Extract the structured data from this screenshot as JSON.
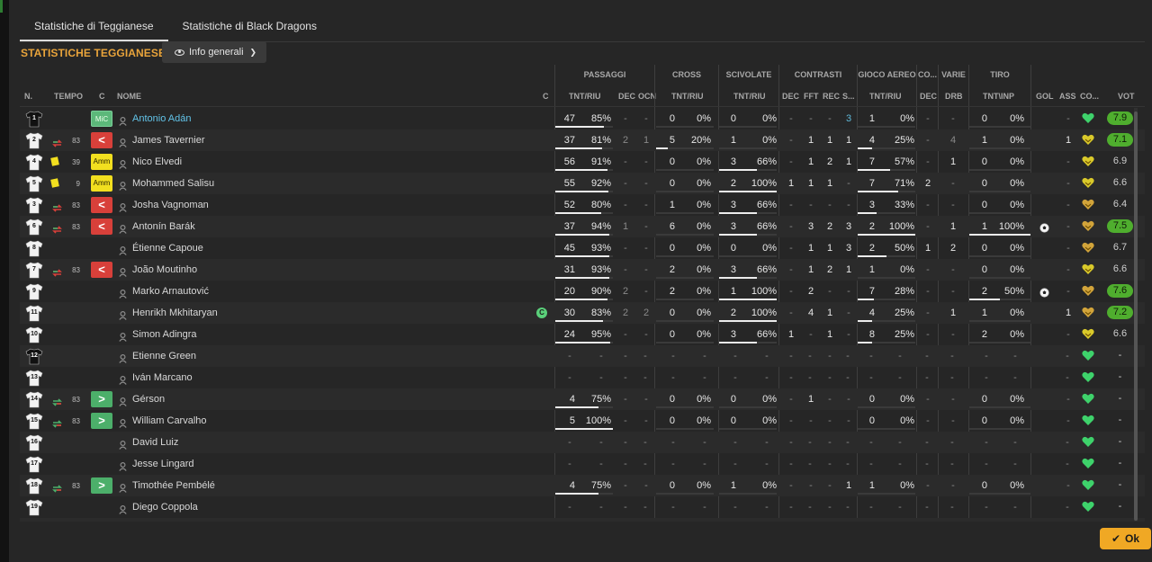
{
  "tabs": [
    {
      "label": "Statistiche di Teggianese",
      "active": true
    },
    {
      "label": "Statistiche di Black Dragons",
      "active": false
    }
  ],
  "section_title": "STATISTICHE TEGGIANESE",
  "view_dropdown": {
    "label": "Info generali"
  },
  "ok_button": {
    "label": "Ok"
  },
  "group_headers": {
    "passaggi": "PASSAGGI",
    "cross": "CROSS",
    "scivolate": "SCIVOLATE",
    "contrasti": "CONTRASTI",
    "gioco_aereo": "GIOCO AEREO",
    "co": "CO...",
    "varie": "VARIE",
    "tiro": "TIRO"
  },
  "column_headers": {
    "n": "N.",
    "tempo": "TEMPO",
    "c": "C",
    "nome": "NOME",
    "cap": "C",
    "pass_tnt_riu": "TNT/RIU",
    "pass_dec": "DEC",
    "pass_ocn": "OCN",
    "cross_tnt_riu": "TNT/RIU",
    "sciv_tnt_riu": "TNT/RIU",
    "contr_dec": "DEC",
    "contr_fft": "FFT",
    "contr_rec": "REC",
    "contr_s": "S...",
    "aereo_tnt_riu": "TNT/RIU",
    "co_dec": "DEC",
    "varie_drb": "DRB",
    "tiro_tnt_inp": "TNT\\INP",
    "gol": "GOL",
    "ass": "ASS",
    "co": "CO...",
    "vot": "VOT"
  },
  "colors": {
    "accent": "#e9a43b",
    "selected_name": "#62c3e8",
    "rating_good": "#4fae2e",
    "sub_out": "#d8403a",
    "sub_in": "#4caf6a",
    "yellow_card": "#f2df1f",
    "heart_green": "#3ed26b",
    "heart_yellow": "#d9c92a",
    "heart_gold": "#d2a43a"
  },
  "players": [
    {
      "n": "1",
      "gk": true,
      "cond": {
        "type": "mic",
        "label": "MiC"
      },
      "name": "Antonio Adán",
      "selected": true,
      "pass": {
        "t": "47",
        "p": "85%",
        "pct": 85,
        "dec": "-",
        "ocn": "-"
      },
      "cross": {
        "t": "0",
        "p": "0%",
        "pct": 0
      },
      "sciv": {
        "t": "0",
        "p": "0%",
        "pct": 0
      },
      "contr": [
        "-",
        "-",
        "-",
        "3"
      ],
      "aereo": {
        "t": "1",
        "p": "0%",
        "pct": 0
      },
      "codec": "-",
      "drb": "-",
      "tiro": {
        "t": "0",
        "p": "0%",
        "pct": 0
      },
      "gol": "",
      "ass": "-",
      "heart": "green",
      "vot": "7.9",
      "vot_good": true
    },
    {
      "n": "2",
      "sub": "out",
      "minute": "83",
      "cond": {
        "type": "out",
        "label": "<"
      },
      "name": "James Tavernier",
      "pass": {
        "t": "37",
        "p": "81%",
        "pct": 81,
        "dec": "2",
        "ocn": "1"
      },
      "cross": {
        "t": "5",
        "p": "20%",
        "pct": 20
      },
      "sciv": {
        "t": "1",
        "p": "0%",
        "pct": 0
      },
      "contr": [
        "-",
        "1",
        "1",
        "1"
      ],
      "aereo": {
        "t": "4",
        "p": "25%",
        "pct": 25
      },
      "codec": "-",
      "drb": "4",
      "tiro": {
        "t": "1",
        "p": "0%",
        "pct": 0
      },
      "gol": "",
      "ass": "1",
      "heart": "yellow",
      "vot": "7.1",
      "vot_good": true
    },
    {
      "n": "4",
      "card": "yellow",
      "minute": "39",
      "cond": {
        "type": "amm",
        "label": "Amm"
      },
      "name": "Nico Elvedi",
      "pass": {
        "t": "56",
        "p": "91%",
        "pct": 91,
        "dec": "-",
        "ocn": "-"
      },
      "cross": {
        "t": "0",
        "p": "0%",
        "pct": 0
      },
      "sciv": {
        "t": "3",
        "p": "66%",
        "pct": 66
      },
      "contr": [
        "-",
        "1",
        "2",
        "1"
      ],
      "aereo": {
        "t": "7",
        "p": "57%",
        "pct": 57
      },
      "codec": "-",
      "drb": "1",
      "tiro": {
        "t": "0",
        "p": "0%",
        "pct": 0
      },
      "gol": "",
      "ass": "-",
      "heart": "yellow",
      "vot": "6.9",
      "vot_good": false
    },
    {
      "n": "5",
      "card": "yellow",
      "minute": "9",
      "cond": {
        "type": "amm",
        "label": "Amm"
      },
      "name": "Mohammed Salisu",
      "pass": {
        "t": "55",
        "p": "92%",
        "pct": 92,
        "dec": "-",
        "ocn": "-"
      },
      "cross": {
        "t": "0",
        "p": "0%",
        "pct": 0
      },
      "sciv": {
        "t": "2",
        "p": "100%",
        "pct": 100
      },
      "contr": [
        "1",
        "1",
        "1",
        "-"
      ],
      "aereo": {
        "t": "7",
        "p": "71%",
        "pct": 71
      },
      "codec": "2",
      "drb": "-",
      "tiro": {
        "t": "0",
        "p": "0%",
        "pct": 0
      },
      "gol": "",
      "ass": "-",
      "heart": "yellow",
      "vot": "6.6",
      "vot_good": false
    },
    {
      "n": "3",
      "sub": "out",
      "minute": "83",
      "cond": {
        "type": "out",
        "label": "<"
      },
      "name": "Josha Vagnoman",
      "pass": {
        "t": "52",
        "p": "80%",
        "pct": 80,
        "dec": "-",
        "ocn": "-"
      },
      "cross": {
        "t": "1",
        "p": "0%",
        "pct": 0
      },
      "sciv": {
        "t": "3",
        "p": "66%",
        "pct": 66
      },
      "contr": [
        "-",
        "-",
        "-",
        "-"
      ],
      "aereo": {
        "t": "3",
        "p": "33%",
        "pct": 33
      },
      "codec": "-",
      "drb": "-",
      "tiro": {
        "t": "0",
        "p": "0%",
        "pct": 0
      },
      "gol": "",
      "ass": "-",
      "heart": "gold",
      "vot": "6.4",
      "vot_good": false
    },
    {
      "n": "6",
      "sub": "out",
      "minute": "83",
      "cond": {
        "type": "out",
        "label": "<"
      },
      "name": "Antonín Barák",
      "pass": {
        "t": "37",
        "p": "94%",
        "pct": 94,
        "dec": "1",
        "ocn": "-"
      },
      "cross": {
        "t": "6",
        "p": "0%",
        "pct": 0
      },
      "sciv": {
        "t": "3",
        "p": "66%",
        "pct": 66
      },
      "contr": [
        "-",
        "3",
        "2",
        "3"
      ],
      "aereo": {
        "t": "2",
        "p": "100%",
        "pct": 100
      },
      "codec": "-",
      "drb": "1",
      "tiro": {
        "t": "1",
        "p": "100%",
        "pct": 100
      },
      "gol": "ball",
      "ass": "-",
      "heart": "gold",
      "vot": "7.5",
      "vot_good": true
    },
    {
      "n": "8",
      "name": "Étienne Capoue",
      "pass": {
        "t": "45",
        "p": "93%",
        "pct": 93,
        "dec": "-",
        "ocn": "-"
      },
      "cross": {
        "t": "0",
        "p": "0%",
        "pct": 0
      },
      "sciv": {
        "t": "0",
        "p": "0%",
        "pct": 0
      },
      "contr": [
        "-",
        "1",
        "1",
        "3"
      ],
      "aereo": {
        "t": "2",
        "p": "50%",
        "pct": 50
      },
      "codec": "1",
      "drb": "2",
      "tiro": {
        "t": "0",
        "p": "0%",
        "pct": 0
      },
      "gol": "",
      "ass": "-",
      "heart": "gold",
      "vot": "6.7",
      "vot_good": false
    },
    {
      "n": "7",
      "sub": "out",
      "minute": "83",
      "cond": {
        "type": "out",
        "label": "<"
      },
      "name": "João Moutinho",
      "pass": {
        "t": "31",
        "p": "93%",
        "pct": 93,
        "dec": "-",
        "ocn": "-"
      },
      "cross": {
        "t": "2",
        "p": "0%",
        "pct": 0
      },
      "sciv": {
        "t": "3",
        "p": "66%",
        "pct": 66
      },
      "contr": [
        "-",
        "1",
        "2",
        "1"
      ],
      "aereo": {
        "t": "1",
        "p": "0%",
        "pct": 0
      },
      "codec": "-",
      "drb": "-",
      "tiro": {
        "t": "0",
        "p": "0%",
        "pct": 0
      },
      "gol": "",
      "ass": "-",
      "heart": "yellow",
      "vot": "6.6",
      "vot_good": false
    },
    {
      "n": "9",
      "name": "Marko Arnautović",
      "pass": {
        "t": "20",
        "p": "90%",
        "pct": 90,
        "dec": "2",
        "ocn": "-"
      },
      "cross": {
        "t": "2",
        "p": "0%",
        "pct": 0
      },
      "sciv": {
        "t": "1",
        "p": "100%",
        "pct": 100
      },
      "contr": [
        "-",
        "2",
        "-",
        "-"
      ],
      "aereo": {
        "t": "7",
        "p": "28%",
        "pct": 28
      },
      "codec": "-",
      "drb": "-",
      "tiro": {
        "t": "2",
        "p": "50%",
        "pct": 50
      },
      "gol": "ball",
      "ass": "-",
      "heart": "gold",
      "vot": "7.6",
      "vot_good": true
    },
    {
      "n": "11",
      "captain": true,
      "name": "Henrikh Mkhitaryan",
      "pass": {
        "t": "30",
        "p": "83%",
        "pct": 83,
        "dec": "2",
        "ocn": "2"
      },
      "cross": {
        "t": "0",
        "p": "0%",
        "pct": 0
      },
      "sciv": {
        "t": "2",
        "p": "100%",
        "pct": 100
      },
      "contr": [
        "-",
        "4",
        "1",
        "-"
      ],
      "aereo": {
        "t": "4",
        "p": "25%",
        "pct": 25
      },
      "codec": "-",
      "drb": "1",
      "tiro": {
        "t": "1",
        "p": "0%",
        "pct": 0
      },
      "gol": "",
      "ass": "1",
      "heart": "gold",
      "vot": "7.2",
      "vot_good": true
    },
    {
      "n": "10",
      "name": "Simon Adingra",
      "pass": {
        "t": "24",
        "p": "95%",
        "pct": 95,
        "dec": "-",
        "ocn": "-"
      },
      "cross": {
        "t": "0",
        "p": "0%",
        "pct": 0
      },
      "sciv": {
        "t": "3",
        "p": "66%",
        "pct": 66
      },
      "contr": [
        "1",
        "-",
        "1",
        "-"
      ],
      "aereo": {
        "t": "8",
        "p": "25%",
        "pct": 25
      },
      "codec": "-",
      "drb": "-",
      "tiro": {
        "t": "2",
        "p": "0%",
        "pct": 0
      },
      "gol": "",
      "ass": "-",
      "heart": "yellow",
      "vot": "6.6",
      "vot_good": false
    },
    {
      "n": "12",
      "gk": true,
      "name": "Etienne Green",
      "empty": true,
      "heart": "green",
      "vot": "-"
    },
    {
      "n": "13",
      "name": "Iván Marcano",
      "empty": true,
      "heart": "green",
      "vot": "-"
    },
    {
      "n": "14",
      "sub": "in",
      "minute": "83",
      "cond": {
        "type": "in",
        "label": ">"
      },
      "name": "Gérson",
      "pass": {
        "t": "4",
        "p": "75%",
        "pct": 75,
        "dec": "-",
        "ocn": "-"
      },
      "cross": {
        "t": "0",
        "p": "0%",
        "pct": 0
      },
      "sciv": {
        "t": "0",
        "p": "0%",
        "pct": 0
      },
      "contr": [
        "-",
        "1",
        "-",
        "-"
      ],
      "aereo": {
        "t": "0",
        "p": "0%",
        "pct": 0
      },
      "codec": "-",
      "drb": "-",
      "tiro": {
        "t": "0",
        "p": "0%",
        "pct": 0
      },
      "gol": "",
      "ass": "-",
      "heart": "green",
      "vot": "-",
      "vot_good": false
    },
    {
      "n": "15",
      "sub": "in",
      "minute": "83",
      "cond": {
        "type": "in",
        "label": ">"
      },
      "name": "William Carvalho",
      "pass": {
        "t": "5",
        "p": "100%",
        "pct": 100,
        "dec": "-",
        "ocn": "-"
      },
      "cross": {
        "t": "0",
        "p": "0%",
        "pct": 0
      },
      "sciv": {
        "t": "0",
        "p": "0%",
        "pct": 0
      },
      "contr": [
        "-",
        "-",
        "-",
        "-"
      ],
      "aereo": {
        "t": "0",
        "p": "0%",
        "pct": 0
      },
      "codec": "-",
      "drb": "-",
      "tiro": {
        "t": "0",
        "p": "0%",
        "pct": 0
      },
      "gol": "",
      "ass": "-",
      "heart": "green",
      "vot": "-",
      "vot_good": false
    },
    {
      "n": "16",
      "name": "David Luiz",
      "empty": true,
      "heart": "green",
      "vot": "-"
    },
    {
      "n": "17",
      "name": "Jesse Lingard",
      "empty": true,
      "heart": "green",
      "vot": "-"
    },
    {
      "n": "18",
      "sub": "in",
      "minute": "83",
      "cond": {
        "type": "in",
        "label": ">"
      },
      "name": "Timothée Pembélé",
      "pass": {
        "t": "4",
        "p": "75%",
        "pct": 75,
        "dec": "-",
        "ocn": "-"
      },
      "cross": {
        "t": "0",
        "p": "0%",
        "pct": 0
      },
      "sciv": {
        "t": "1",
        "p": "0%",
        "pct": 0
      },
      "contr": [
        "-",
        "-",
        "-",
        "1"
      ],
      "aereo": {
        "t": "1",
        "p": "0%",
        "pct": 0
      },
      "codec": "-",
      "drb": "-",
      "tiro": {
        "t": "0",
        "p": "0%",
        "pct": 0
      },
      "gol": "",
      "ass": "-",
      "heart": "green",
      "vot": "-",
      "vot_good": false
    },
    {
      "n": "19",
      "name": "Diego Coppola",
      "empty": true,
      "heart": "green",
      "vot": "-"
    },
    {
      "n": "",
      "name": "",
      "empty": true,
      "heart": "",
      "vot": ""
    }
  ]
}
